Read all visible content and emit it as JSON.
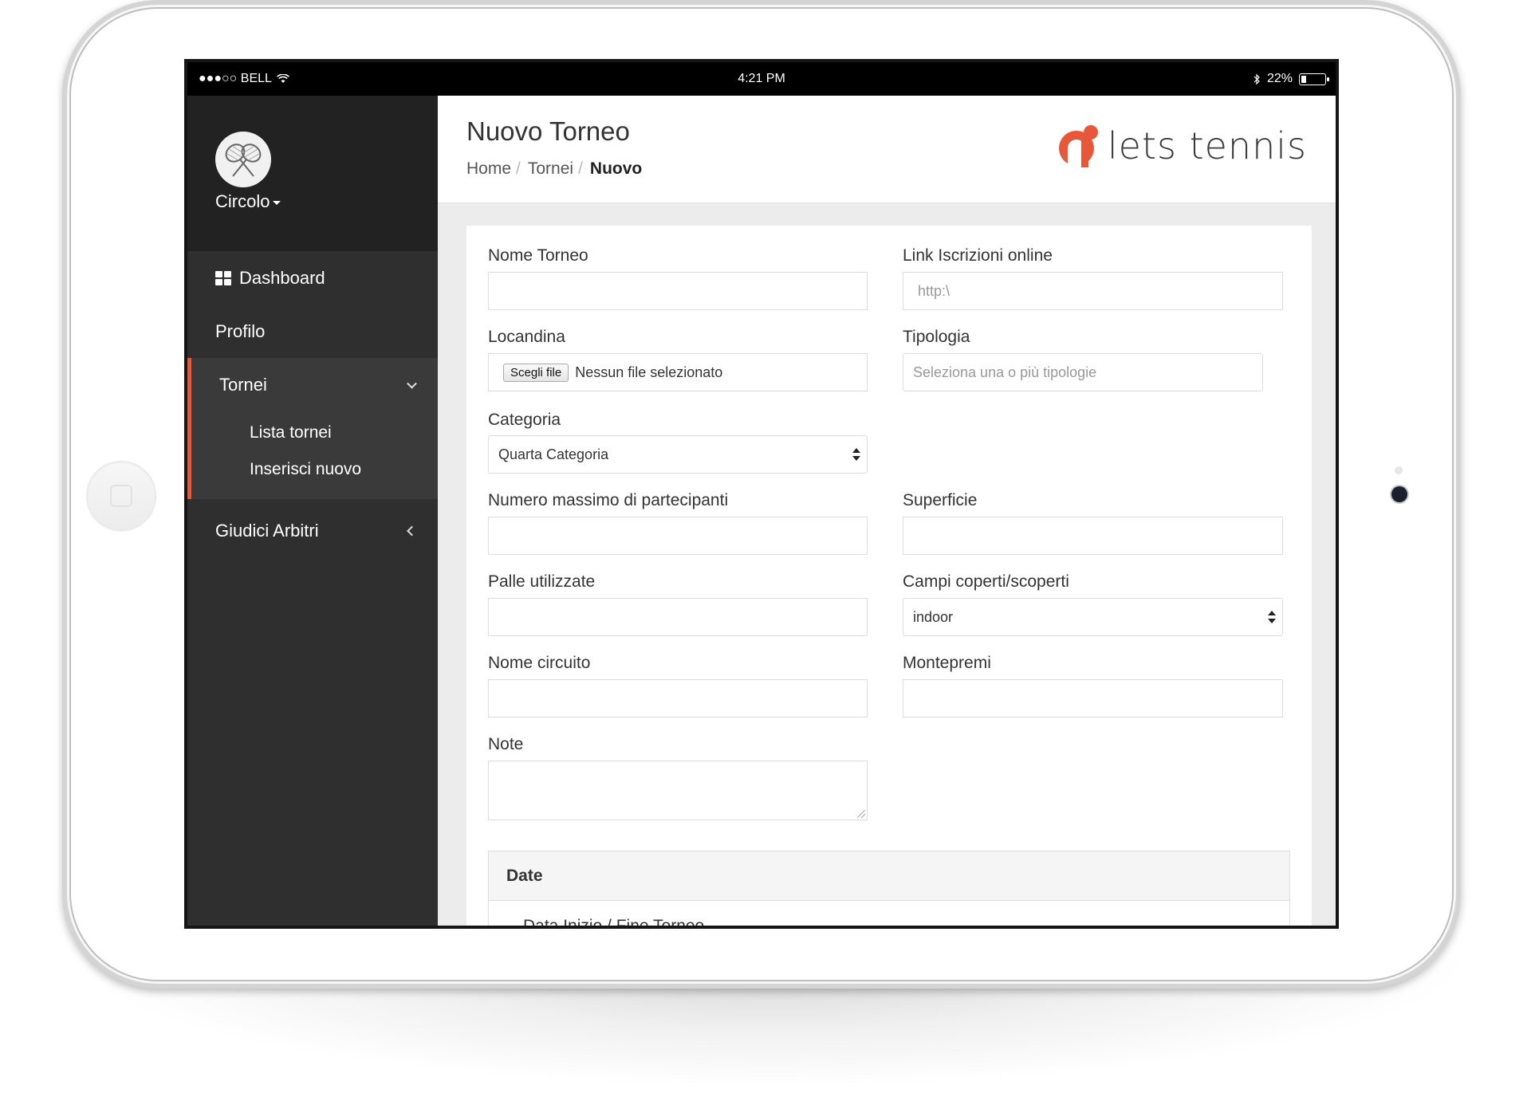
{
  "status_bar": {
    "carrier": "●●●○○ BELL",
    "time": "4:21 PM",
    "battery": "22%",
    "battery_level": 0.22
  },
  "sidebar": {
    "club_label": "Circolo",
    "items": [
      {
        "label": "Dashboard",
        "icon": "dashboard-grid-icon"
      },
      {
        "label": "Profilo"
      }
    ],
    "group": {
      "label": "Tornei",
      "expanded": true,
      "sub_items": [
        {
          "label": "Lista tornei"
        },
        {
          "label": "Inserisci nuovo"
        }
      ]
    },
    "after_group": {
      "label": "Giudici Arbitri"
    }
  },
  "header": {
    "title": "Nuovo Torneo",
    "breadcrumb": [
      "Home",
      "Tornei",
      "Nuovo"
    ],
    "brand": "lets tennis",
    "brand_color": "#e7573a"
  },
  "form": {
    "nome_torneo": {
      "label": "Nome Torneo",
      "value": ""
    },
    "link_iscrizioni": {
      "label": "Link Iscrizioni online",
      "placeholder": "http:\\"
    },
    "locandina": {
      "label": "Locandina",
      "button": "Scegli file",
      "status": "Nessun file selezionato"
    },
    "tipologia": {
      "label": "Tipologia",
      "placeholder": "Seleziona una o più tipologie"
    },
    "categoria": {
      "label": "Categoria",
      "value": "Quarta Categoria"
    },
    "numero_partecipanti": {
      "label": "Numero massimo di partecipanti",
      "value": ""
    },
    "superficie": {
      "label": "Superficie",
      "value": ""
    },
    "palle": {
      "label": "Palle utilizzate",
      "value": ""
    },
    "campi": {
      "label": "Campi coperti/scoperti",
      "value": "indoor"
    },
    "nome_circuito": {
      "label": "Nome circuito",
      "value": ""
    },
    "montepremi": {
      "label": "Montepremi",
      "value": ""
    },
    "note": {
      "label": "Note",
      "value": ""
    },
    "date_section": {
      "title": "Date",
      "sub_label": "Data Inizio / Fine Torneo"
    }
  }
}
